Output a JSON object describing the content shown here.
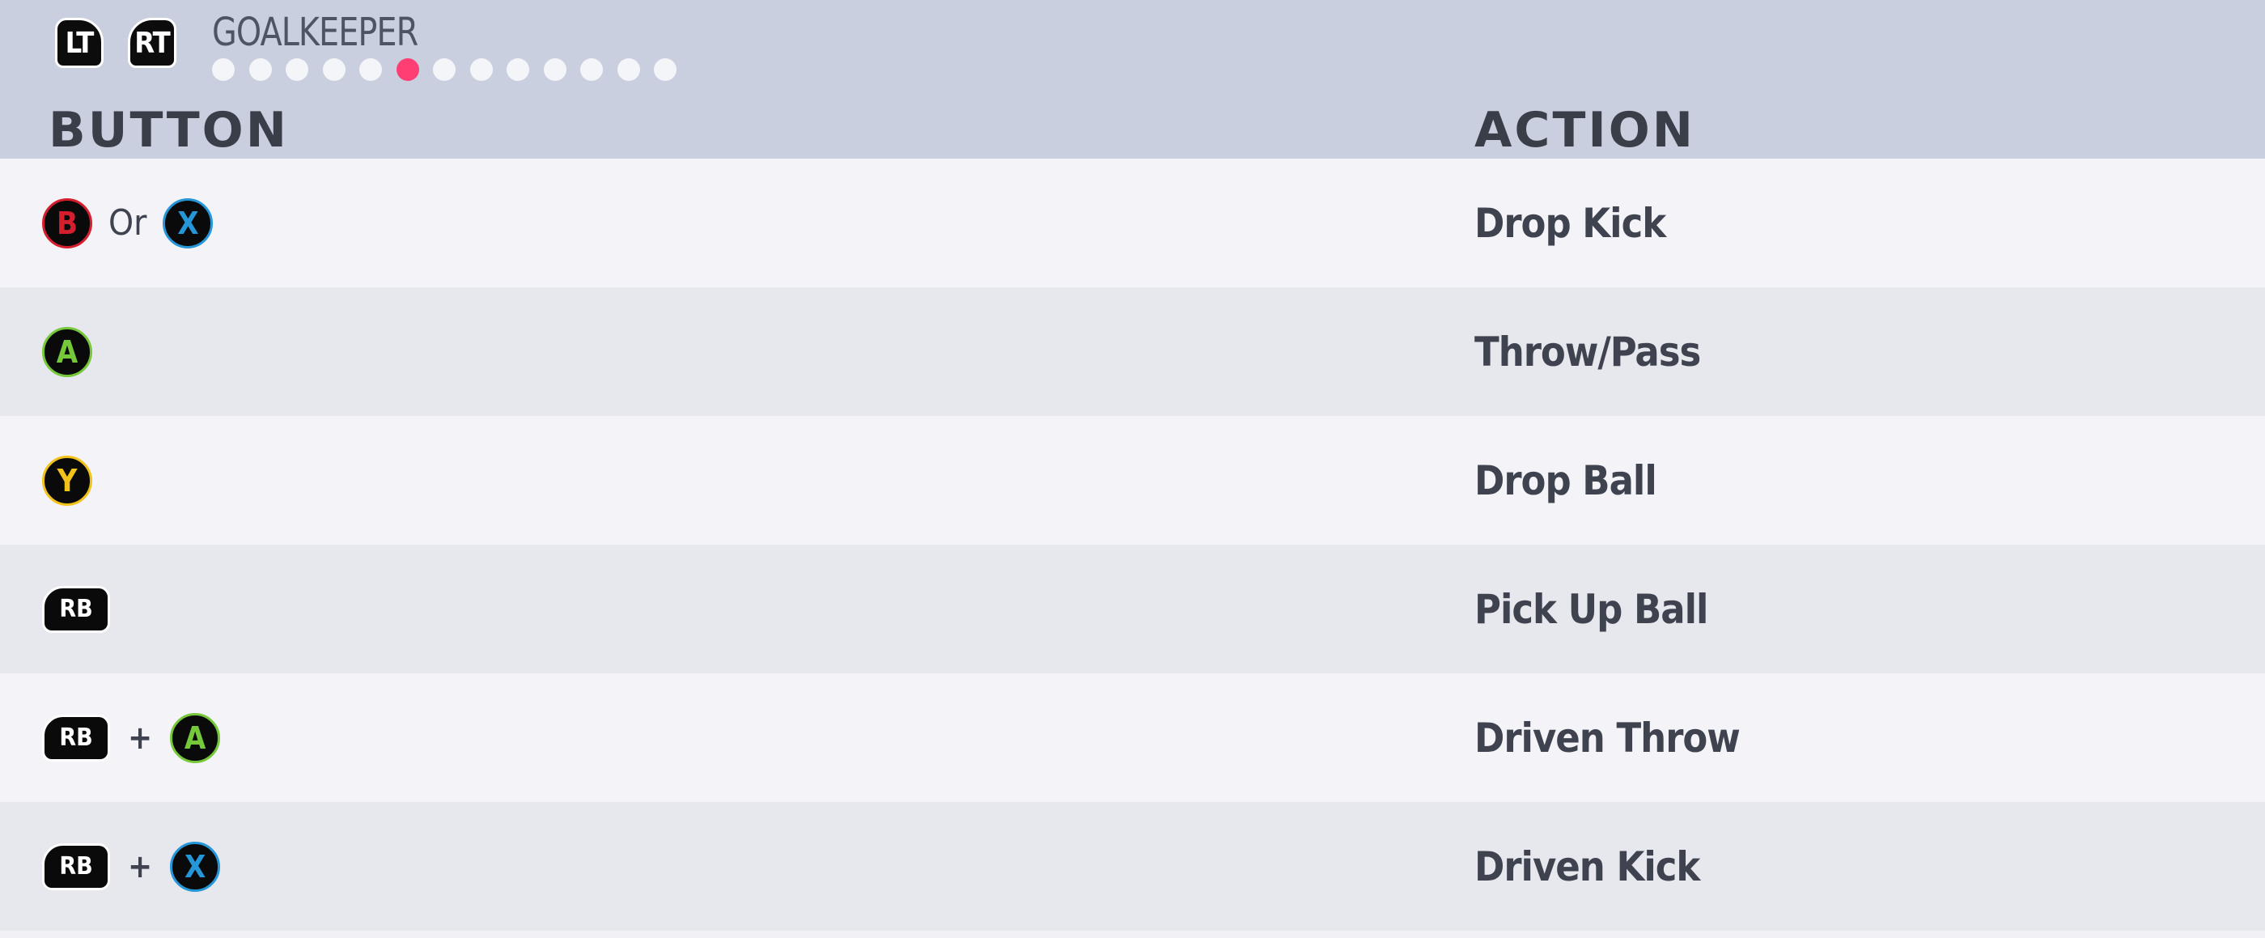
{
  "header": {
    "bumper_left": "LT",
    "bumper_right": "RT",
    "section_title": "GOALKEEPER",
    "pager": {
      "total_pages": 13,
      "active_page": 6
    }
  },
  "columns": {
    "button": "BUTTON",
    "action": "ACTION"
  },
  "colors": {
    "B": "#d51f2e",
    "X": "#2596d8",
    "A": "#75c83a",
    "Y": "#f2c21a",
    "active_dot": "#ff3f74"
  },
  "rows": [
    {
      "action": "Drop Kick",
      "combo": [
        {
          "type": "face",
          "label": "B"
        },
        {
          "type": "sep",
          "label": "Or"
        },
        {
          "type": "face",
          "label": "X"
        }
      ]
    },
    {
      "action": "Throw/Pass",
      "combo": [
        {
          "type": "face",
          "label": "A"
        }
      ]
    },
    {
      "action": "Drop Ball",
      "combo": [
        {
          "type": "face",
          "label": "Y"
        }
      ]
    },
    {
      "action": "Pick Up Ball",
      "combo": [
        {
          "type": "bumper",
          "label": "RB"
        }
      ]
    },
    {
      "action": "Driven Throw",
      "combo": [
        {
          "type": "bumper",
          "label": "RB"
        },
        {
          "type": "plus",
          "label": "+"
        },
        {
          "type": "face",
          "label": "A"
        }
      ]
    },
    {
      "action": "Driven Kick",
      "combo": [
        {
          "type": "bumper",
          "label": "RB"
        },
        {
          "type": "plus",
          "label": "+"
        },
        {
          "type": "face",
          "label": "X"
        }
      ]
    }
  ]
}
